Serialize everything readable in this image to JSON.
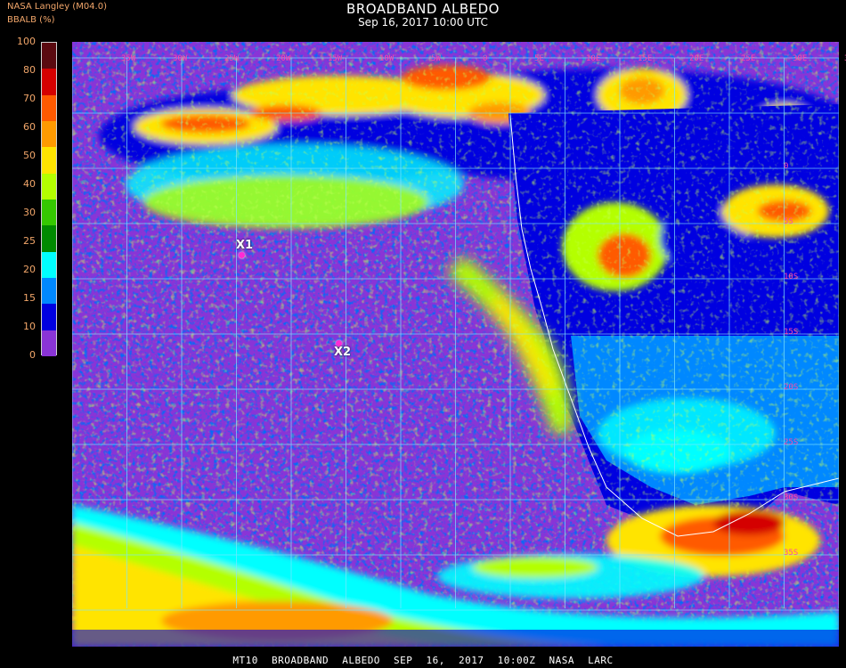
{
  "header": {
    "org_label": "NASA Langley (M04.0)",
    "units_label": "BBALB (%)",
    "title": "BROADBAND ALBEDO",
    "subtitle": "Sep 16, 2017 10:00 UTC"
  },
  "legend": {
    "ticks": [
      "100",
      "80",
      "70",
      "60",
      "50",
      "40",
      "30",
      "25",
      "20",
      "15",
      "10",
      "0"
    ],
    "colors": [
      "#5a0a10",
      "#d40000",
      "#ff5a00",
      "#ff9a00",
      "#ffe400",
      "#b4ff00",
      "#35c800",
      "#008a00",
      "#00ffff",
      "#0088ff",
      "#0000e0",
      "#8a34d6"
    ]
  },
  "grid": {
    "lon_labels": [
      "35W",
      "30W",
      "25W",
      "20W",
      "15W",
      "10W",
      "5W",
      "0",
      "5E",
      "10E",
      "15E",
      "20E",
      "25E",
      "30E",
      "35E"
    ],
    "lat_labels": [
      "0",
      "5S",
      "10S",
      "15S",
      "20S",
      "25S",
      "30S",
      "35S"
    ]
  },
  "markers": [
    {
      "label": "X1"
    },
    {
      "label": "X2"
    }
  ],
  "footer": {
    "text": "MT10 BROADBAND ALBEDO SEP 16, 2017 10:00Z NASA LARC"
  }
}
